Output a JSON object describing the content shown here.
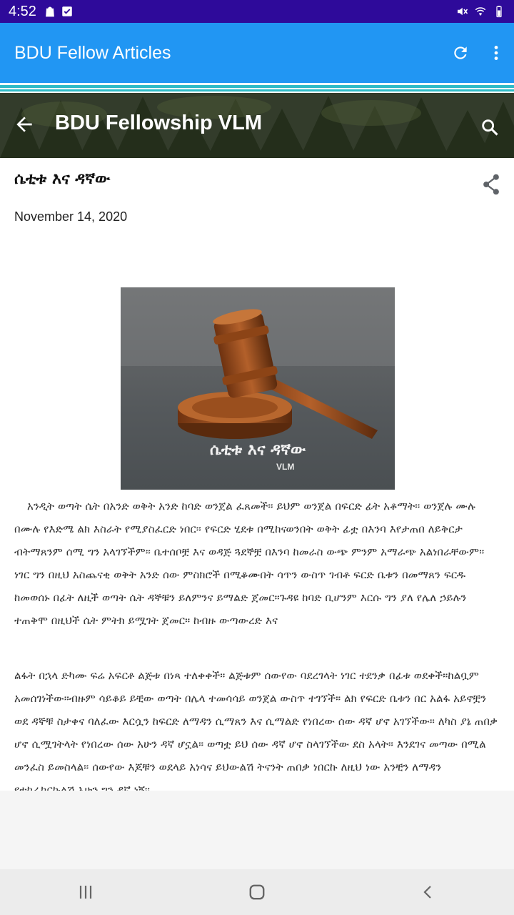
{
  "status_bar": {
    "time": "4:52",
    "left_icons": [
      "bag-icon",
      "checkbox-icon"
    ],
    "right_icons": [
      "mute-icon",
      "wifi-icon",
      "battery-icon"
    ]
  },
  "app_bar": {
    "title": "BDU Fellow Articles",
    "actions": [
      "refresh-icon",
      "more-vert-icon"
    ],
    "color": "#2196f3"
  },
  "blog_header": {
    "title": "BDU Fellowship VLM",
    "back_icon": "arrow-left-icon",
    "search_icon": "search-icon"
  },
  "post": {
    "title": "ሴቲቱ እና ዳኛው",
    "date": "November 14, 2020",
    "share_icon": "share-icon",
    "image_caption": "ሴቲቱ እና ዳኛው",
    "image_logo": "VLM",
    "paragraph1": "አንዲት ወጣት ሴት በአንድ ወቅት አንድ ከባድ ወንጀል ፈጸመች። ይህም ወንጀል በፍርድ ፊት አቆማት። ወንጀሉ ሙሉ በሙሉ የእድሜ ልክ እስራት የሚያስፈርድ ነበር። የፍርድ ሂደቱ በሚከናወንበት ወቅት ፊቷ በእንባ እየታጠበ ለይቅርታ ብትማጸንም ሰሚ ግን አላገኘችም። ቤተሰቦቿ እና ወዳጅ ጓደኞቿ በእንባ ከመራስ ውጭ ምንም አማራጭ አልነበራቸውም። ነገር ግን በዚህ አስጨናቂ ወቅት አንድ ሰው ምስክሮች በሚቆሙበት ሳጥን ውስጥ ገብቶ ፍርድ ቤቱን በመማጸን ፍርዱ ከመወሰኑ በፊት ለዚች ወጣት ሴት ዳኞቹን ይለምንና ይማልድ ጀመር።ጉዳዩ ከባድ ቢሆንም እርሱ ግን ያለ የሌለ ኃይሉን ተጠቅሞ በዚህች ሴት ምትክ ይሟገት ጀመር። ከብዙ ውጣውረድ እና",
    "paragraph2": "ልፋት በኋላ ድካሙ ፍሬ አፍርቶ ልጅቱ በነጻ ተለቀቀች። ልጅቱም ሰውየው ባደረገላት ነገር ተደንቃ በፊቱ ወደቀች።ከልቧም አመሰገነችው።ብዙም ሳይቆይ ይቺው ወጣት በሌላ ተመሳሳይ ወንጀል ውስጥ ተገኘች። ልክ የፍርድ ቤቱን በር አልፋ አይኖቿን ወደ ዳኞቹ ስታቀና ባለፈው እርሷን ከፍርድ ለማዳን ሲማጸን እና ሲማልድ የነበረው ሰው ዳኛ ሆኖ አገኘችው። ለካስ ያኔ ጠበቃ ሆኖ ሲሟገትላት የነበረው ሰው አሁን ዳኛ ሆኗል። ወጣቷ ይህ ሰው ዳኛ ሆኖ ስላገኘችው ደስ አላት። እንደገና መጣው በሚል መንፈስ ይመስላል። ሰውየው እጆቹን ወደላይ አነሳና ይህውልሽ ትናንት ጠበቃ ነበርኩ ለዚህ ነው አንቺን ለማዳን የተከራከርኩልሽ አሁን ግን ዳኛ ነኝ።"
  },
  "nav_bar": {
    "buttons": [
      "recents-icon",
      "home-icon",
      "back-icon"
    ]
  }
}
